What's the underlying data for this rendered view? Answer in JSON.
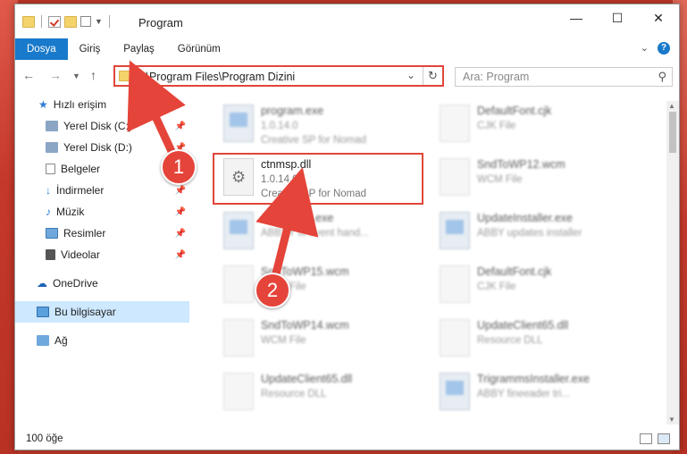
{
  "window": {
    "title": "Program"
  },
  "ribbon": {
    "tabs": [
      {
        "label": "Dosya",
        "active": true
      },
      {
        "label": "Giriş"
      },
      {
        "label": "Paylaş"
      },
      {
        "label": "Görünüm"
      }
    ]
  },
  "address": {
    "path": "C:\\Program Files\\Program Dizini"
  },
  "search": {
    "placeholder": "Ara: Program"
  },
  "sidebar": {
    "items": [
      {
        "label": "Hızlı erişim",
        "icon": "star-icon",
        "pinned": false
      },
      {
        "label": "Yerel Disk (C:)",
        "icon": "drive-icon",
        "pinned": true
      },
      {
        "label": "Yerel Disk (D:)",
        "icon": "drive-icon",
        "pinned": true
      },
      {
        "label": "Belgeler",
        "icon": "documents-icon",
        "pinned": true
      },
      {
        "label": "İndirmeler",
        "icon": "download-icon",
        "pinned": true
      },
      {
        "label": "Müzik",
        "icon": "music-icon",
        "pinned": true
      },
      {
        "label": "Resimler",
        "icon": "pictures-icon",
        "pinned": true
      },
      {
        "label": "Videolar",
        "icon": "videos-icon",
        "pinned": true
      },
      {
        "label": "OneDrive",
        "icon": "cloud-icon"
      },
      {
        "label": "Bu bilgisayar",
        "icon": "computer-icon",
        "selected": true
      },
      {
        "label": "Ağ",
        "icon": "network-icon"
      }
    ]
  },
  "files": [
    {
      "name": "program.exe",
      "line2": "1.0.14.0",
      "line3": "Creative SP for Nomad",
      "type": "app"
    },
    {
      "name": "DefaultFont.cjk",
      "line2": "CJK File",
      "line3": "",
      "type": "doc"
    },
    {
      "name": "ctnmsp.dll",
      "line2": "1.0.14.0",
      "line3": "Creative SP for Nomad",
      "type": "dll",
      "highlighted": true
    },
    {
      "name": "SndToWP12.wcm",
      "line2": "WCM File",
      "line3": "",
      "type": "doc"
    },
    {
      "name": "AbbyyISTI.exe",
      "line2": "ABBYY to event hand...",
      "line3": "",
      "type": "app"
    },
    {
      "name": "UpdateInstaller.exe",
      "line2": "ABBY updates installer",
      "line3": "",
      "type": "app"
    },
    {
      "name": "SndToWP15.wcm",
      "line2": "WCM File",
      "line3": "",
      "type": "doc"
    },
    {
      "name": "DefaultFont.cjk",
      "line2": "CJK File",
      "line3": "",
      "type": "doc"
    },
    {
      "name": "SndToWP14.wcm",
      "line2": "WCM File",
      "line3": "",
      "type": "doc"
    },
    {
      "name": "UpdateClient65.dll",
      "line2": "Resource DLL",
      "line3": "",
      "type": "dll"
    },
    {
      "name": "UpdateClient65.dll",
      "line2": "Resource DLL",
      "line3": "",
      "type": "dll"
    },
    {
      "name": "TrigrammsInstaller.exe",
      "line2": "ABBY fineeader tri...",
      "line3": "",
      "type": "app"
    }
  ],
  "status": {
    "count": "100 öğe"
  },
  "annotations": {
    "step1": "1",
    "step2": "2"
  },
  "colors": {
    "accent": "#1979ca",
    "highlight": "#e0463a"
  }
}
